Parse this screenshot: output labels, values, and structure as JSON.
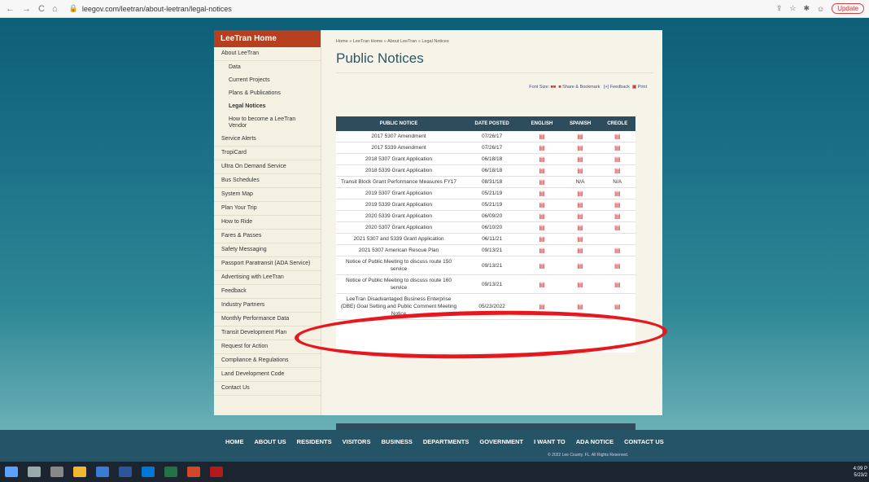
{
  "browser": {
    "url": "leegov.com/leetran/about-leetran/legal-notices",
    "update_label": "Update"
  },
  "sidebar": {
    "home": "LeeTran Home",
    "items": [
      "About LeeTran",
      "Data",
      "Current Projects",
      "Plans & Publications",
      "Legal Notices",
      "How to become a LeeTran Vendor",
      "Service Alerts",
      "TropiCard",
      "Ultra On Demand Service",
      "Bus Schedules",
      "System Map",
      "Plan Your Trip",
      "How to Ride",
      "Fares & Passes",
      "Safety Messaging",
      "Passport Paratransit (ADA Service)",
      "Advertising with LeeTran",
      "Feedback",
      "Industry Partners",
      "Monthly Performance Data",
      "Transit Development Plan",
      "Request for Action",
      "Compliance & Regulations",
      "Land Development Code",
      "Contact Us"
    ]
  },
  "page": {
    "breadcrumb": "Home » LeeTran Home » About LeeTran » Legal Notices",
    "title": "Public Notices",
    "font_size": "Font Size:",
    "share": "Share & Bookmark",
    "feedback": "[+] Feedback",
    "print": "Print"
  },
  "table": {
    "headers": [
      "PUBLIC NOTICE",
      "DATE POSTED",
      "ENGLISH",
      "SPANISH",
      "CREOLE"
    ],
    "rows": [
      [
        "2017 5307 Amendment",
        "07/26/17",
        "pdf",
        "pdf",
        "pdf"
      ],
      [
        "2017 5339 Amendment",
        "07/26/17",
        "pdf",
        "pdf",
        "pdf"
      ],
      [
        "2018 5307 Grant Application",
        "06/18/18",
        "pdf",
        "pdf",
        "pdf"
      ],
      [
        "2018 5339 Grant Application",
        "06/18/18",
        "pdf",
        "pdf",
        "pdf"
      ],
      [
        "Transit Block Grant Performance Measures FY17",
        "08/31/18",
        "pdf",
        "N/A",
        "N/A"
      ],
      [
        "2019 5307 Grant Application",
        "05/21/19",
        "pdf",
        "pdf",
        "pdf"
      ],
      [
        "2019 5339 Grant Application",
        "05/21/19",
        "pdf",
        "pdf",
        "pdf"
      ],
      [
        "2020 5339 Grant Application",
        "06/09/20",
        "pdf",
        "pdf",
        "pdf"
      ],
      [
        "2020 5307 Grant Application",
        "06/10/20",
        "pdf",
        "pdf",
        "pdf"
      ],
      [
        "2021 5307 and 5339 Grant Application",
        "06/11/21",
        "pdf",
        "pdf",
        ""
      ],
      [
        "2021 5307 American Rescue Plan",
        "09/13/21",
        "pdf",
        "pdf",
        "pdf"
      ],
      [
        "Notice of Public Meeting to discuss route 150 service",
        "09/13/21",
        "pdf",
        "pdf",
        "pdf"
      ],
      [
        "Notice of Public Meeting to discuss route 160 service",
        "09/13/21",
        "pdf",
        "pdf",
        "pdf"
      ],
      [
        "LeeTran Disadvantaged Business Enterprise (DBE) Goal Setting and Public Comment Meeting Notice",
        "05/23/2022",
        "pdf",
        "pdf",
        "pdf"
      ]
    ]
  },
  "footer": {
    "nav": [
      "HOME",
      "ABOUT US",
      "RESIDENTS",
      "VISITORS",
      "BUSINESS",
      "DEPARTMENTS",
      "GOVERNMENT",
      "I WANT TO",
      "ADA NOTICE",
      "CONTACT US"
    ],
    "copyright": "© 2022 Lee County, FL. All Rights Reserved."
  },
  "clock": {
    "time": "4:09 P",
    "date": "5/23/2"
  }
}
